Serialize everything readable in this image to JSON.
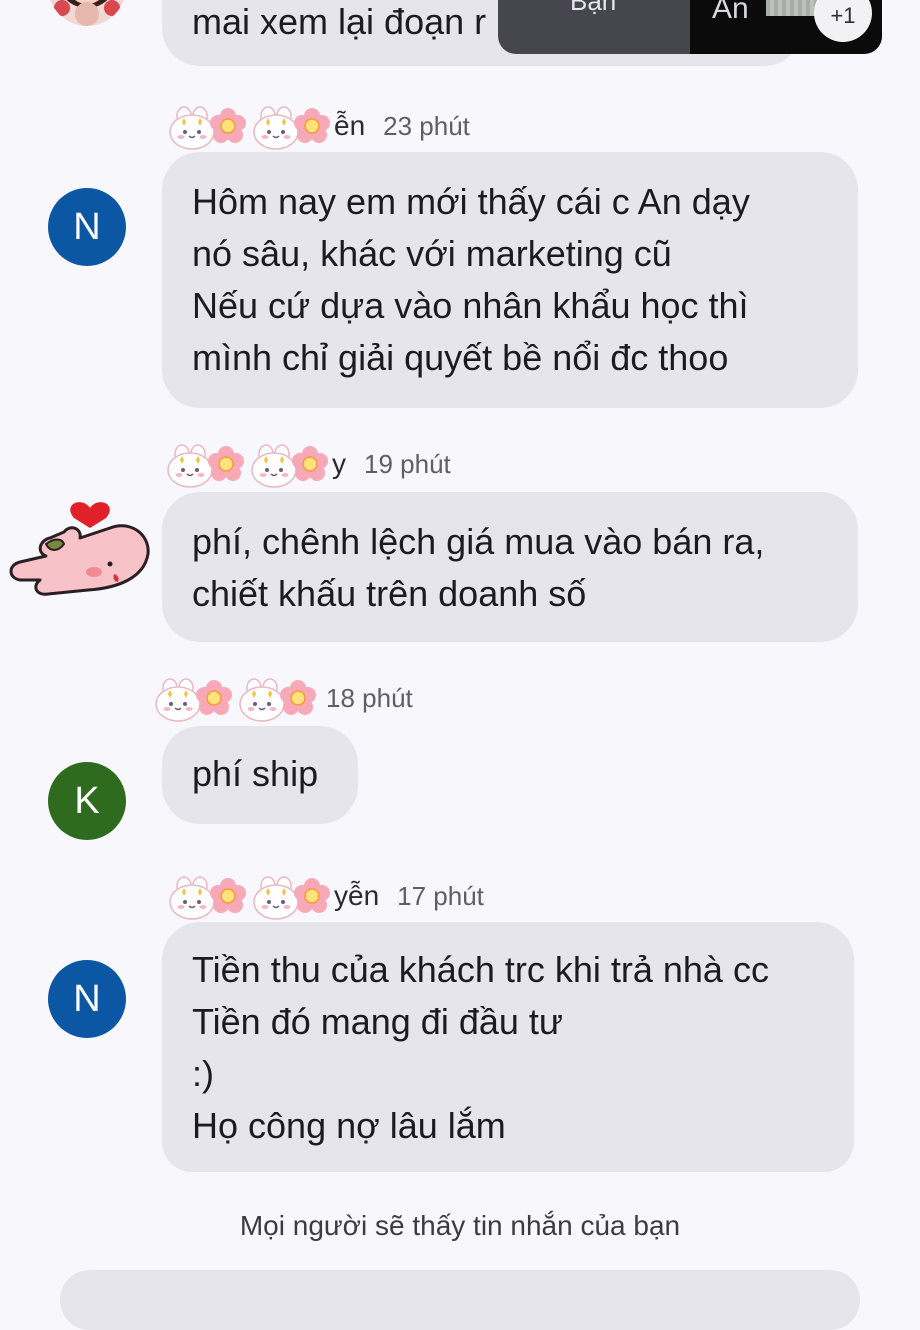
{
  "colors": {
    "background": "#f8f7fc",
    "bubble": "#e6e5ec",
    "avatar_n": "#0b57a4",
    "avatar_k": "#2e6b1e"
  },
  "call_overlay": {
    "label": "Bạn",
    "participant": "An",
    "extra_count": "+1"
  },
  "messages": [
    {
      "avatar": "photo",
      "lines": [
        "mai xem lại đoạn r"
      ]
    },
    {
      "sender_fragment": "ễn",
      "time": "23 phút",
      "avatar": "N",
      "lines": [
        "Hôm nay em mới thấy cái c An dạy",
        "nó sâu, khác với marketing cũ",
        "Nếu cứ dựa vào nhân khẩu học thì",
        "mình chỉ giải quyết bề nổi đc thoo"
      ]
    },
    {
      "sender_fragment": "y",
      "time": "19 phút",
      "avatar": "sticker-hand-heart",
      "lines": [
        "phí, chênh lệch giá mua vào bán ra,",
        "chiết khấu trên doanh số"
      ]
    },
    {
      "sender_fragment": "",
      "time": "18 phút",
      "avatar": "K",
      "lines": [
        "phí ship"
      ]
    },
    {
      "sender_fragment": "yễn",
      "time": "17 phút",
      "avatar": "N",
      "lines": [
        "Tiền thu của khách trc khi trả nhà cc",
        "Tiền đó mang đi đầu tư",
        ":)",
        "Họ công nợ lâu lắm"
      ]
    }
  ],
  "footer_note": "Mọi người sẽ thấy tin nhắn của bạn",
  "icons": {
    "sender_decoration": "bunny-flower-sticker-icon",
    "profile_photo": "profile-photo-icon",
    "hand_sticker": "hand-heart-sticker-icon"
  }
}
